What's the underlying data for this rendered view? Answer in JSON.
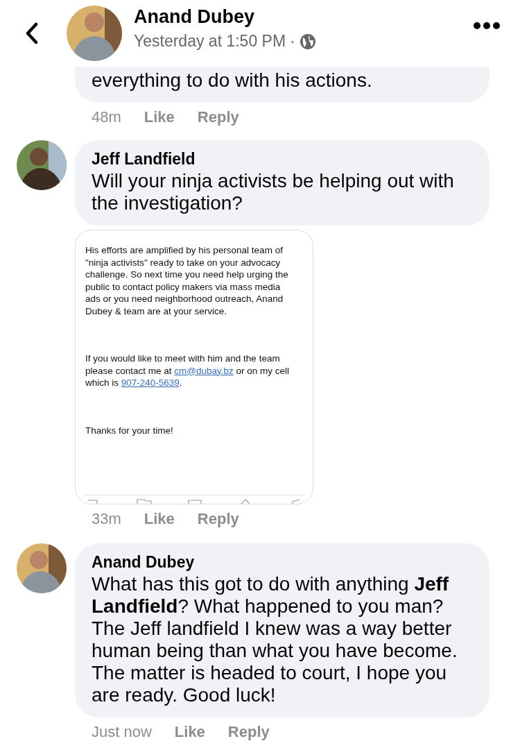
{
  "header": {
    "author": "Anand Dubey",
    "time": "Yesterday at 1:50 PM",
    "separator": "·"
  },
  "comments": [
    {
      "text": "everything to do with his actions.",
      "time": "48m",
      "like": "Like",
      "reply": "Reply"
    },
    {
      "author": "Jeff Landfield",
      "text": "Will your ninja activists be helping out with the investigation?",
      "attachment": {
        "kind": "screenshot",
        "paragraphs": [
          [
            {
              "kind": "text",
              "text": "His efforts are amplified by his personal team of \"ninja activists\" ready to take on your advocacy challenge. So next time you need help urging the public to contact policy makers via  mass media ads or you need neighborhood outreach, Anand Dubey & team are at your service."
            }
          ],
          [
            {
              "kind": "text",
              "text": "If you would like to meet with him and the team please contact me at "
            },
            {
              "kind": "link",
              "text": "cm@dubay.bz"
            },
            {
              "kind": "text",
              "text": " or on my cell which is "
            },
            {
              "kind": "link",
              "text": "907-240-5639"
            },
            {
              "kind": "text",
              "text": "."
            }
          ],
          [
            {
              "kind": "text",
              "text": "Thanks for your time!"
            }
          ]
        ]
      },
      "time": "33m",
      "like": "Like",
      "reply": "Reply"
    },
    {
      "author": "Anand Dubey",
      "text": "What has this got to do with anything **Jeff Landfield**? What happened to you man? The Jeff  landfield I knew was a way better human being than what you have become. The matter is headed to court, I hope you are ready. Good luck!",
      "time": "Just now",
      "like": "Like",
      "reply": "Reply"
    }
  ]
}
